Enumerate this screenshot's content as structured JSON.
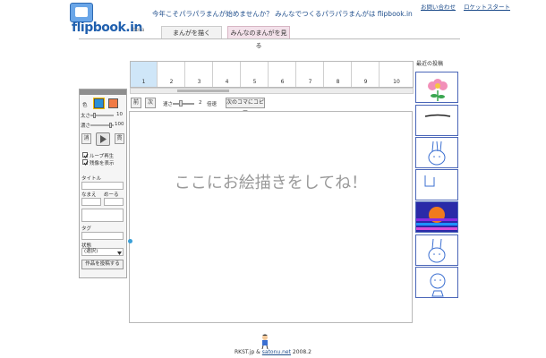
{
  "header": {
    "logo_text": "flipbook.in",
    "logo_beta": "beta",
    "tagline": "今年こそパラパラまんが始めませんか？ みんなでつくるパラパラまんがは flipbook.in",
    "links": [
      "お問い合わせ",
      "ロケットスタート"
    ]
  },
  "tabs": [
    "まんがを描く",
    "みんなのまんがを見る"
  ],
  "frames": [
    "1",
    "2",
    "3",
    "4",
    "5",
    "6",
    "7",
    "8",
    "9",
    "10"
  ],
  "toolbar": {
    "prev_label": "前",
    "next_label": "次",
    "speed_label": "速さ",
    "speed_value": "2",
    "speed_unit": "倍速",
    "copy_label": "次のコマにコピー"
  },
  "panel": {
    "color_label": "色",
    "thickness_label": "太さ",
    "thickness_value": "10",
    "density_label": "濃さ",
    "density_value": "100",
    "btn_left": "消",
    "btn_right": "貫",
    "loop_label": "ループ再生",
    "afterimage_label": "残像を表示",
    "title_label": "タイトル",
    "name_label": "なまえ",
    "pass_label": "めーる",
    "tag_label": "タグ",
    "status_label": "状態",
    "status_value": "(選択)",
    "submit_label": "作品を投稿する",
    "colors": {
      "primary": "#2a8fd6",
      "secondary": "#f07a45"
    }
  },
  "canvas": {
    "hint": "ここにお絵描きをしてね！"
  },
  "recent": {
    "title": "最近の投稿"
  },
  "footer": {
    "site1": "RKST.jp",
    "amp": "&",
    "site2": "satonu.net",
    "year": "2008.2"
  },
  "colors": {
    "accent": "#1f5fae",
    "frame_selected": "#cfe6f8",
    "thumb_border": "#4a66b8"
  }
}
